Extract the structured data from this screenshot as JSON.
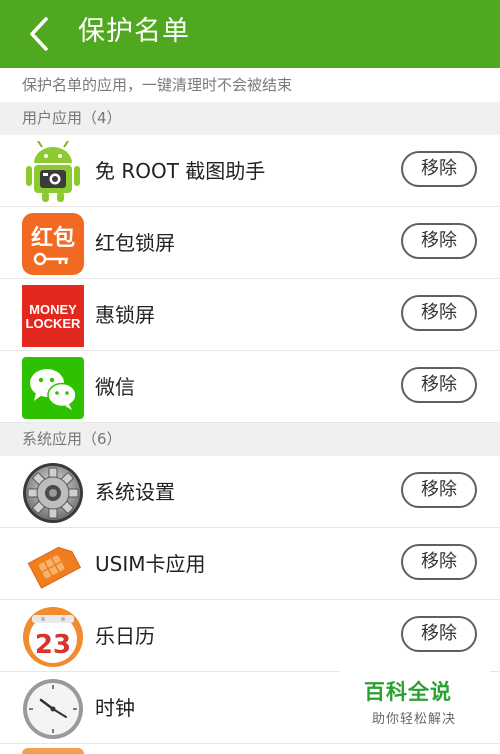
{
  "header": {
    "title": "保护名单",
    "back_icon": "chevron-left-icon"
  },
  "description": "保护名单的应用，一键清理时不会被结束",
  "sections": [
    {
      "header": "用户应用（4）",
      "items": [
        {
          "name": "免 ROOT 截图助手",
          "action": "移除",
          "icon": "android-camera-icon"
        },
        {
          "name": "红包锁屏",
          "action": "移除",
          "icon": "hongbao-key-icon",
          "icon_text": "红包"
        },
        {
          "name": "惠锁屏",
          "action": "移除",
          "icon": "money-locker-icon",
          "icon_text": [
            "MONEY",
            "LOCKER"
          ]
        },
        {
          "name": "微信",
          "action": "移除",
          "icon": "wechat-icon"
        }
      ]
    },
    {
      "header": "系统应用（6）",
      "items": [
        {
          "name": "系统设置",
          "action": "移除",
          "icon": "gear-icon"
        },
        {
          "name": "USIM卡应用",
          "action": "移除",
          "icon": "sim-card-icon"
        },
        {
          "name": "乐日历",
          "action": "移除",
          "icon": "calendar-icon",
          "icon_text": "23"
        },
        {
          "name": "时钟",
          "action": "",
          "icon": "clock-icon"
        }
      ]
    }
  ],
  "watermark": {
    "title": "百科全说",
    "subtitle": "助你轻松解决"
  },
  "colors": {
    "appbar": "#4fa81f",
    "section_bg": "#f0f0f0",
    "watermark_green": "#2aa232"
  }
}
